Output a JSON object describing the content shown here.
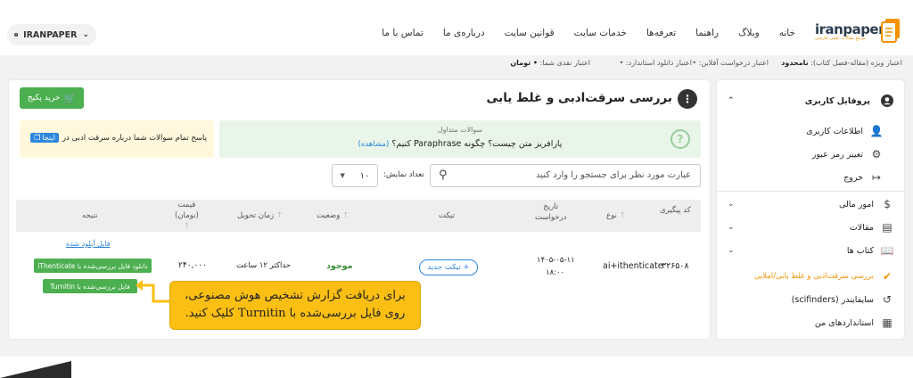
{
  "header": {
    "logo_text": "iranpaper",
    "logo_sub": "مرجع مقالات علمی فارسی",
    "menu": [
      "خانه",
      "وبلاگ",
      "راهنما",
      "تعرفه‌ها",
      "خدمات سایت",
      "قوانین سایت",
      "درباره‌ی ما",
      "تماس با ما"
    ],
    "user_label": "IRANPAPER"
  },
  "credits": {
    "special_label": "اعتبار ویژه (مقاله-فصل کتاب):",
    "special_value": "نامحدود",
    "request_label": "اعتبار درخواست آفلاین:",
    "request_value": "•",
    "standard_label": "اعتبار دانلود استاندارد:",
    "standard_value": "•",
    "cash_label": "اعتبار نقدی شما:",
    "cash_value": "• تومان"
  },
  "sidebar": {
    "profile": "پروفایل کاربری",
    "user_info": "اطلاعات کاربری",
    "change_password": "تغییر رمز عبور",
    "logout": "خروج",
    "finance": "امور مالی",
    "articles": "مقالات",
    "books": "کتاب ها",
    "plagiarism": "بررسی سرقت‌ادبی و غلط یابی/املایی",
    "scifinders": "سایفایندر (scifinders)",
    "standards": "استانداردهای من"
  },
  "main": {
    "title": "بررسی سرقت‌ادبی و غلط یابی",
    "buy_button": "خرید پکیج",
    "faq_label": "سوالات متداول",
    "faq_question": "پارافریز متن چیست؟ چگونه Paraphrase کنیم؟",
    "faq_link": "(مشاهده)",
    "faq_all": "پاسخ تمام سوالات شما درباره سرقت ادبی در",
    "faq_here": "اینجا",
    "search_placeholder": "عبارت مورد نظر برای جستجو را وارد کنید",
    "per_page_label": "تعداد نمایش:",
    "per_page_value": "۱۰"
  },
  "table": {
    "headers": {
      "code": "کد پیگیری",
      "type": "نوع",
      "date_1": "تاریخ",
      "date_2": "درخواست",
      "ticket": "تیکت",
      "status": "وضعیت",
      "delivery": "زمان تحویل",
      "price_1": "قیمت",
      "price_2": "(تومان)",
      "result": "نتیجه"
    },
    "row": {
      "code": "۳۲۶۵۰۸",
      "type": "ai+ithenticate",
      "date": "۱۴۰۵-۰۵-۱۱",
      "time": "۱۸:۰۰",
      "ticket_button": "+ تیکت جدید",
      "status": "موجود",
      "delivery": "حداکثر ۱۲ ساعت",
      "price": "۲۴۰,۰۰۰",
      "uploaded_link": "فایل آپلود شده",
      "ithenticate_button": "دانلود فایل بررسی‌شده با iThenticate",
      "turnitin_button": "فایل بررسی‌شده با Turnitin"
    }
  },
  "tooltip": {
    "line1": "برای دریافت گزارش تشخیص هوش مصنوعی،",
    "line2": "روی فایل بررسی‌شده با Turnitin کلیک کنید."
  },
  "colors": {
    "accent": "#f39200",
    "green": "#4caf50",
    "tooltip": "#fbbf14",
    "link": "#2e86de"
  }
}
